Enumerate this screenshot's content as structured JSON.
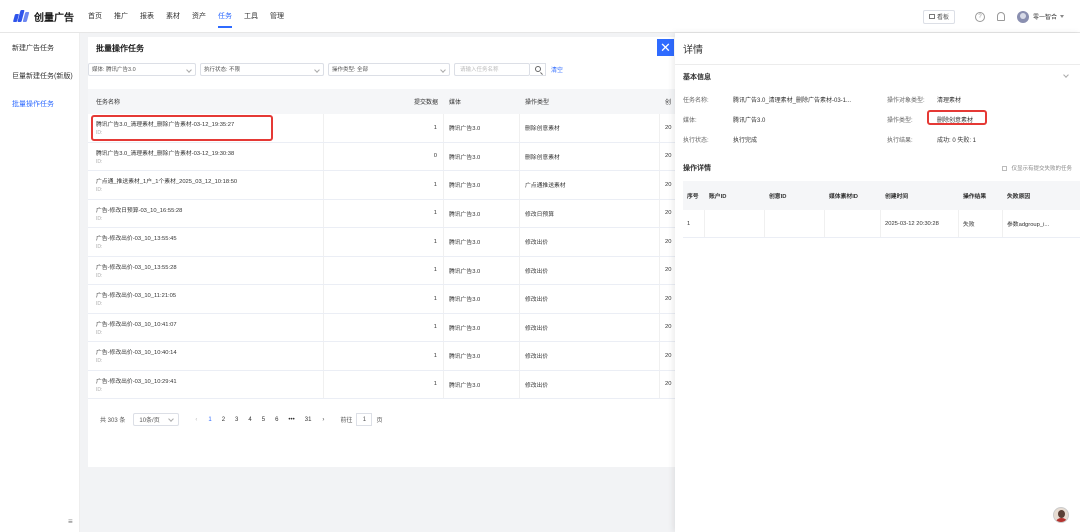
{
  "app": {
    "logo_text": "创量广告",
    "brand_color": "#2f54eb",
    "accent_color": "#2f6bff",
    "nav": [
      "首页",
      "推广",
      "报表",
      "素材",
      "资产",
      "任务",
      "工具",
      "管理"
    ],
    "active_nav": "任务",
    "kanban_label": "看板",
    "user_name": "零一智合"
  },
  "sidebar": {
    "items": [
      "新建广告任务",
      "巨量新建任务(新版)",
      "批量操作任务"
    ],
    "active": "批量操作任务",
    "collapse_icon": "≡"
  },
  "list": {
    "title": "批量操作任务",
    "filters": {
      "media": "媒体: 腾讯广告3.0",
      "status": "执行状态: 不限",
      "op_type": "操作类型: 全部",
      "search_placeholder": "请输入任务名称",
      "clear_label": "清空"
    },
    "columns": [
      "任务名称",
      "提交数据",
      "媒体",
      "操作类型",
      "创"
    ],
    "rows": [
      {
        "name": "腾讯广告3.0_清理素材_删除广告素材-03-12_19:35:27",
        "id": "ID:",
        "count": "1",
        "media": "腾讯广告3.0",
        "type": "删除创意素材",
        "more": "20"
      },
      {
        "name": "腾讯广告3.0_清理素材_删除广告素材-03-12_19:30:38",
        "id": "ID:",
        "count": "0",
        "media": "腾讯广告3.0",
        "type": "删除创意素材",
        "more": "20"
      },
      {
        "name": "广点通_推送素材_1户_1个素材_2025_03_12_10:18:50",
        "id": "ID:",
        "count": "1",
        "media": "腾讯广告3.0",
        "type": "广点通推送素材",
        "more": "20"
      },
      {
        "name": "广告-修改日预算-03_10_16:55:28",
        "id": "ID:",
        "count": "1",
        "media": "腾讯广告3.0",
        "type": "修改日预算",
        "more": "20"
      },
      {
        "name": "广告-修改出价-03_10_13:55:45",
        "id": "ID:",
        "count": "1",
        "media": "腾讯广告3.0",
        "type": "修改出价",
        "more": "20"
      },
      {
        "name": "广告-修改出价-03_10_13:55:28",
        "id": "ID:",
        "count": "1",
        "media": "腾讯广告3.0",
        "type": "修改出价",
        "more": "20"
      },
      {
        "name": "广告-修改出价-03_10_11:21:05",
        "id": "ID:",
        "count": "1",
        "media": "腾讯广告3.0",
        "type": "修改出价",
        "more": "20"
      },
      {
        "name": "广告-修改出价-03_10_10:41:07",
        "id": "ID:",
        "count": "1",
        "media": "腾讯广告3.0",
        "type": "修改出价",
        "more": "20"
      },
      {
        "name": "广告-修改出价-03_10_10:40:14",
        "id": "ID:",
        "count": "1",
        "media": "腾讯广告3.0",
        "type": "修改出价",
        "more": "20"
      },
      {
        "name": "广告-修改出价-03_10_10:29:41",
        "id": "ID:",
        "count": "1",
        "media": "腾讯广告3.0",
        "type": "修改出价",
        "more": "20"
      }
    ],
    "pager": {
      "total": "共 303 条",
      "page_size": "10条/页",
      "prev": "‹",
      "pages": [
        "1",
        "2",
        "3",
        "4",
        "5",
        "6",
        "•••",
        "31"
      ],
      "current": "1",
      "next": "›",
      "goto_label": "前往",
      "goto_value": "1",
      "page_unit": "页"
    }
  },
  "drawer": {
    "close_icon": "✕",
    "title": "详情",
    "basic_title": "基本信息",
    "fields": {
      "task_name_label": "任务名称:",
      "task_name": "腾讯广告3.0_清理素材_删除广告素材-03-1...",
      "target_type_label": "操作对象类型:",
      "target_type": "清理素材",
      "media_label": "媒体:",
      "media": "腾讯广告3.0",
      "op_type_label": "操作类型:",
      "op_type": "删除创意素材",
      "status_label": "执行状态:",
      "status": "执行完成",
      "result_label": "执行结果:",
      "result": "成功: 0 失败: 1"
    },
    "detail_title": "操作详情",
    "only_fail_label": "仅显示有提交失败的任务",
    "detail_columns": [
      "序号",
      "账户ID",
      "创意ID",
      "媒体素材ID",
      "创建时间",
      "操作结果",
      "失败原因"
    ],
    "detail_rows": [
      {
        "idx": "1",
        "account": "",
        "creative": "",
        "material": "",
        "time": "2025-03-12 20:30:28",
        "result": "失败",
        "reason": "参数adgroup_i..."
      }
    ],
    "highlight_color": "#e53935"
  }
}
